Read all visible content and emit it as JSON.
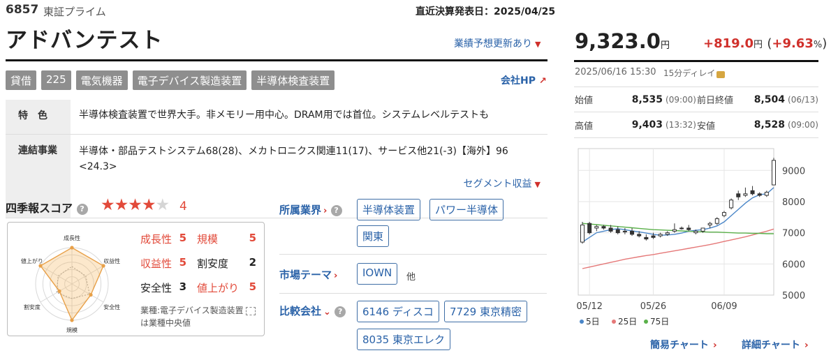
{
  "header": {
    "code": "6857",
    "market": "東証プライム",
    "settlement": "直近決算発表日：2025/04/25",
    "company_name": "アドバンテスト",
    "forecast_update": "業績予想更新あり"
  },
  "tags": [
    "貸借",
    "225",
    "電気機器",
    "電子デバイス製造装置",
    "半導体検査装置"
  ],
  "company_hp": "会社HP",
  "info": {
    "feature_label": "特　色",
    "feature_text": "半導体検査装置で世界大手。非メモリー用中心。DRAM用では首位。システムレベルテストも",
    "business_label": "連結事業",
    "business_text": "半導体・部品テストシステム68(28)、メカトロニクス関連11(17)、サービス他21(-3)【海外】96 <24.3>",
    "segment_link": "セグメント収益"
  },
  "score": {
    "title": "四季報スコア",
    "help": "?",
    "rating": 4,
    "max_rating": 5,
    "value": "4",
    "radar_axes": [
      "成長性",
      "収益性",
      "安全性",
      "規模",
      "割安度",
      "値上がり"
    ],
    "radar_company": [
      5,
      5,
      3,
      5,
      2,
      5
    ],
    "items": [
      {
        "label": "成長性",
        "value": "5",
        "highlight": true
      },
      {
        "label": "規模",
        "value": "5",
        "highlight": true
      },
      {
        "label": "収益性",
        "value": "5",
        "highlight": true
      },
      {
        "label": "割安度",
        "value": "2",
        "highlight": false
      },
      {
        "label": "安全性",
        "value": "3",
        "highlight": false
      },
      {
        "label": "値上がり",
        "value": "5",
        "highlight": true
      }
    ],
    "note_prefix": "業種:電子デバイス製造装置",
    "note_suffix": "は業種中央値"
  },
  "industry": {
    "title": "所属業界",
    "chips": [
      "半導体装置",
      "パワー半導体",
      "関東"
    ]
  },
  "theme": {
    "title": "市場テーマ",
    "chips": [
      "IOWN"
    ],
    "other": "他"
  },
  "peers": {
    "title": "比較会社",
    "chips": [
      "6146 ディスコ",
      "7729 東京精密",
      "8035 東京エレク"
    ]
  },
  "quote": {
    "price": "9,323.0",
    "price_unit": "円",
    "change": "+819.0",
    "change_unit": "円",
    "change_pct": "+9.63",
    "pct_unit": "%",
    "datetime": "2025/06/16 15:30",
    "delay": "15分ディレイ",
    "ohlc": [
      {
        "label": "始値",
        "value": "8,535",
        "time": "(09:00)"
      },
      {
        "label": "前日終値",
        "value": "8,504",
        "time": "(06/13)"
      },
      {
        "label": "高値",
        "value": "9,403",
        "time": "(13:32)"
      },
      {
        "label": "安値",
        "value": "8,528",
        "time": "(09:00)"
      }
    ]
  },
  "chart_data": {
    "type": "candlestick",
    "x_ticks": [
      "05/12",
      "05/26",
      "06/09"
    ],
    "y_ticks": [
      "9000",
      "8000",
      "7000",
      "6000",
      "5000"
    ],
    "ylim": [
      5000,
      9700
    ],
    "candles": [
      {
        "o": 6700,
        "h": 7350,
        "l": 6650,
        "c": 7250
      },
      {
        "o": 7300,
        "h": 7350,
        "l": 6950,
        "c": 7000
      },
      {
        "o": 7150,
        "h": 7250,
        "l": 7050,
        "c": 7200
      },
      {
        "o": 7200,
        "h": 7250,
        "l": 7100,
        "c": 7150
      },
      {
        "o": 7150,
        "h": 7250,
        "l": 7000,
        "c": 7050
      },
      {
        "o": 7100,
        "h": 7200,
        "l": 6950,
        "c": 7000
      },
      {
        "o": 7050,
        "h": 7150,
        "l": 6950,
        "c": 7050
      },
      {
        "o": 7050,
        "h": 7150,
        "l": 6900,
        "c": 6950
      },
      {
        "o": 6950,
        "h": 7050,
        "l": 6850,
        "c": 6900
      },
      {
        "o": 6850,
        "h": 6950,
        "l": 6750,
        "c": 6800
      },
      {
        "o": 6900,
        "h": 7000,
        "l": 6800,
        "c": 6850
      },
      {
        "o": 6900,
        "h": 7000,
        "l": 6850,
        "c": 6950
      },
      {
        "o": 6950,
        "h": 7050,
        "l": 6900,
        "c": 7000
      },
      {
        "o": 7050,
        "h": 7300,
        "l": 7000,
        "c": 7100
      },
      {
        "o": 7150,
        "h": 7200,
        "l": 7100,
        "c": 7150
      },
      {
        "o": 7150,
        "h": 7250,
        "l": 7050,
        "c": 7100
      },
      {
        "o": 7000,
        "h": 7100,
        "l": 6950,
        "c": 7050
      },
      {
        "o": 7050,
        "h": 7150,
        "l": 7000,
        "c": 7150
      },
      {
        "o": 7250,
        "h": 7350,
        "l": 7150,
        "c": 7300
      },
      {
        "o": 7300,
        "h": 7500,
        "l": 7250,
        "c": 7450
      },
      {
        "o": 7550,
        "h": 7700,
        "l": 7500,
        "c": 7650
      },
      {
        "o": 7800,
        "h": 8100,
        "l": 7750,
        "c": 8050
      },
      {
        "o": 8250,
        "h": 8350,
        "l": 8050,
        "c": 8150
      },
      {
        "o": 8200,
        "h": 8450,
        "l": 8150,
        "c": 8250
      },
      {
        "o": 8350,
        "h": 8500,
        "l": 8200,
        "c": 8250
      },
      {
        "o": 8250,
        "h": 8300,
        "l": 8150,
        "c": 8200
      },
      {
        "o": 8200,
        "h": 8350,
        "l": 8150,
        "c": 8300
      },
      {
        "o": 8535,
        "h": 9403,
        "l": 8528,
        "c": 9323
      }
    ],
    "series": [
      {
        "name": "5日",
        "color": "#4a86c8",
        "values": [
          6700,
          6850,
          7000,
          7050,
          7100,
          7130,
          7100,
          7060,
          7030,
          6990,
          6950,
          6920,
          6930,
          6950,
          6990,
          7050,
          7080,
          7100,
          7150,
          7220,
          7350,
          7550,
          7750,
          7950,
          8120,
          8220,
          8250,
          8450
        ]
      },
      {
        "name": "25日",
        "color": "#e57878",
        "values": [
          5850,
          5900,
          5950,
          6000,
          6050,
          6100,
          6150,
          6190,
          6230,
          6270,
          6300,
          6340,
          6380,
          6420,
          6460,
          6500,
          6540,
          6580,
          6620,
          6670,
          6720,
          6770,
          6820,
          6870,
          6930,
          6990,
          7050,
          7120
        ]
      },
      {
        "name": "75日",
        "color": "#5ab04a",
        "values": [
          7300,
          7280,
          7260,
          7240,
          7220,
          7200,
          7180,
          7160,
          7140,
          7120,
          7100,
          7090,
          7080,
          7070,
          7060,
          7050,
          7040,
          7030,
          7020,
          7020,
          7010,
          7000,
          6990,
          6990,
          6980,
          6980,
          6970,
          6970
        ]
      }
    ]
  },
  "chart_links": {
    "simple": "簡易チャート",
    "detail": "詳細チャート"
  }
}
